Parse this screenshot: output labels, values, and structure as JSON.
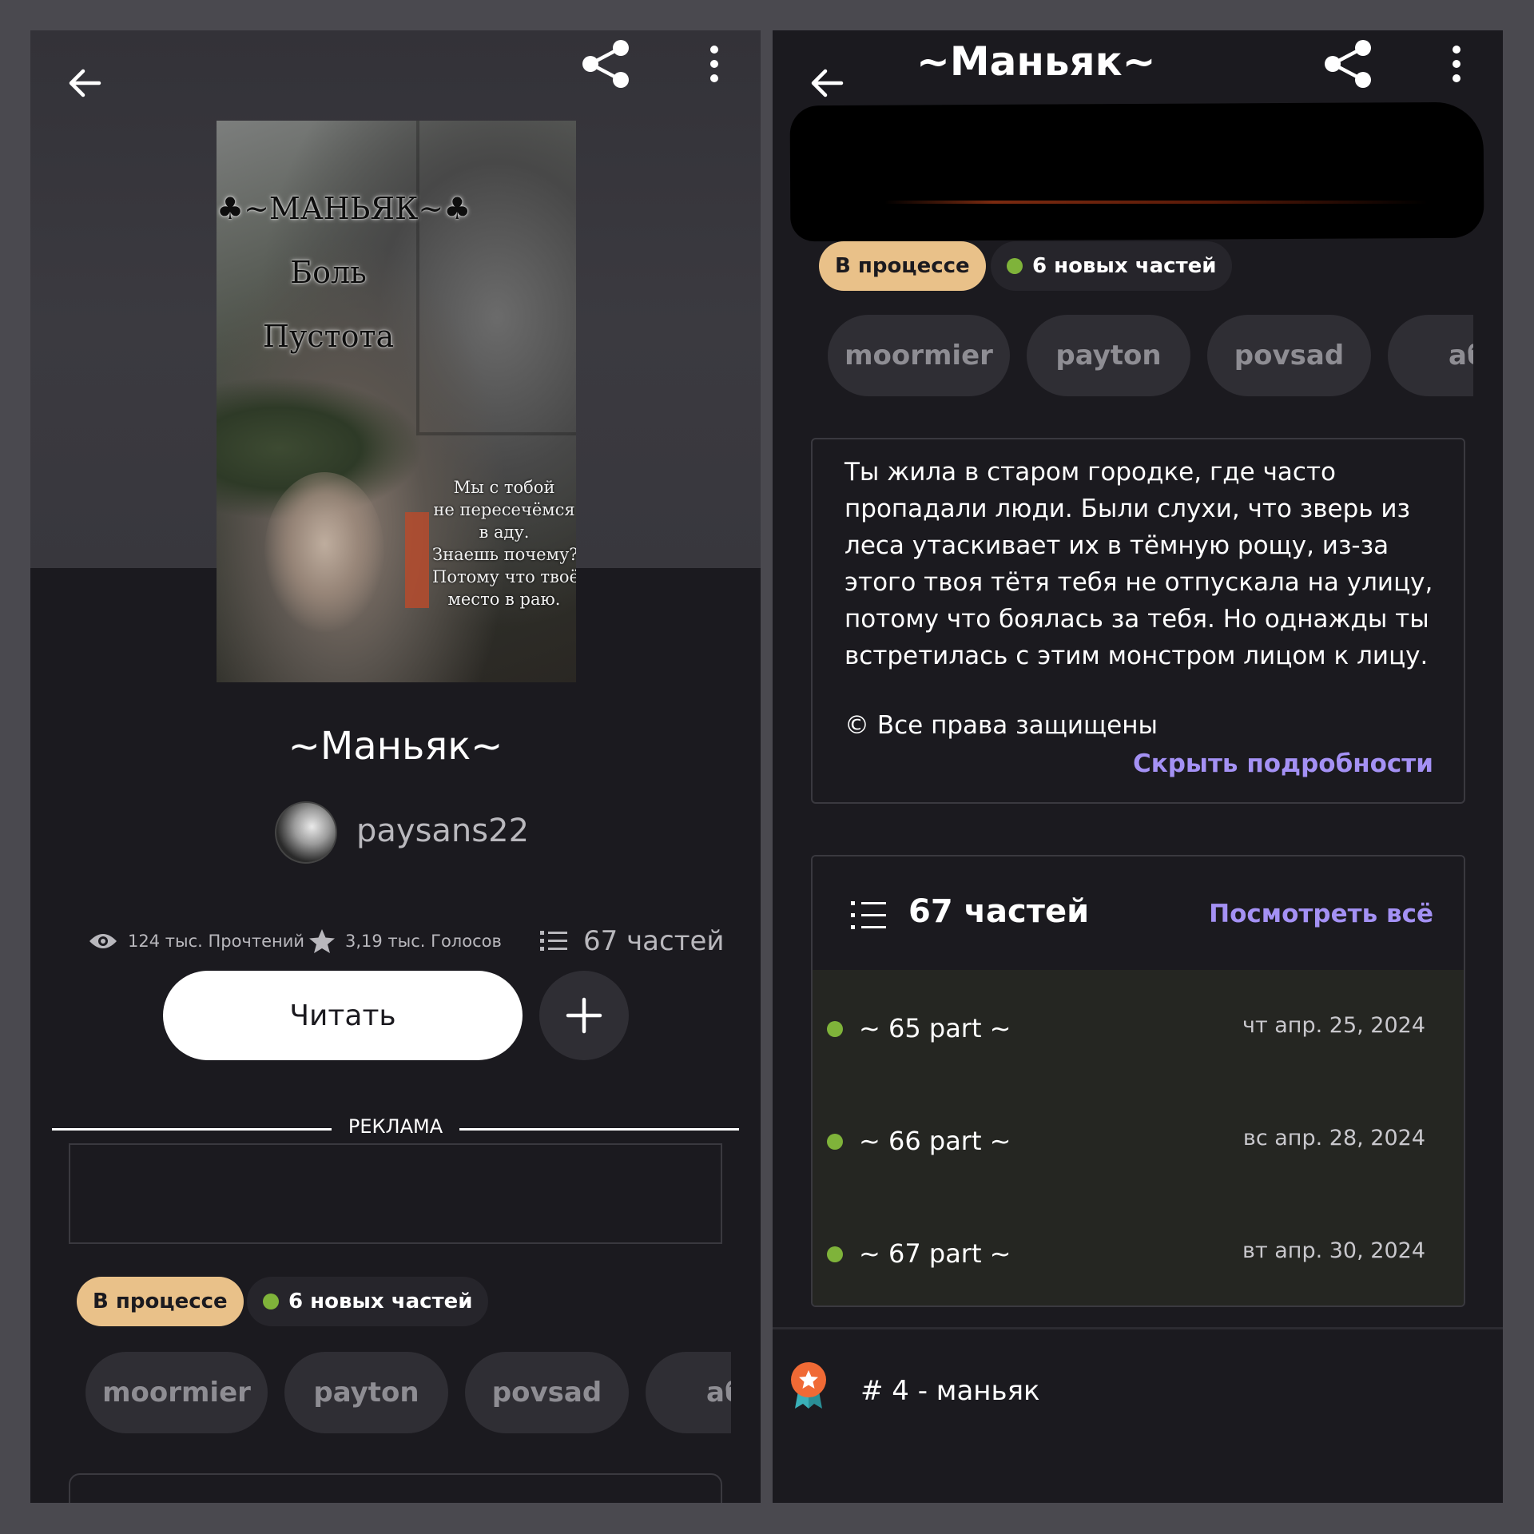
{
  "left": {
    "cover": {
      "title_lines": [
        "♣~МАНЬЯК~♣",
        "Боль",
        "Пустота"
      ],
      "quote_lines": [
        "Мы с тобой",
        "не пересечёмся",
        "в аду.",
        "Знаешь почему?",
        "Потому что твоё",
        "место в раю."
      ]
    },
    "title": "~Маньяк~",
    "author": "paysans22",
    "stats": {
      "reads": "124 тыс. Прочтений",
      "votes": "3,19 тыс. Голосов",
      "parts": "67 частей"
    },
    "read_label": "Читать",
    "add_label": "+",
    "ad_label": "РЕКЛАМА",
    "status_badge": "В процессе",
    "new_parts_badge": "6 новых частей",
    "tags": [
      "moormier",
      "payton",
      "povsad",
      "аб"
    ]
  },
  "right": {
    "title": "~Маньяк~",
    "status_badge": "В процессе",
    "new_parts_badge": "6 новых частей",
    "tags": [
      "moormier",
      "payton",
      "povsad",
      "аб"
    ],
    "description_lines": [
      "Ты жила в старом городке, где часто",
      "пропадали люди. Были слухи, что зверь из",
      "леса утаскивает их в тёмную рощу, из-за",
      "этого твоя тётя тебя не отпускала на улицу,",
      "потому что боялась за тебя. Но однажды ты",
      "встретилась с этим монстром лицом к лицу."
    ],
    "copyright": "© Все права защищены",
    "hide_details": "Скрыть подробности",
    "parts_count": "67 частей",
    "view_all": "Посмотреть всё",
    "parts": [
      {
        "title": "~ 65 part ~",
        "date": "чт апр. 25, 2024"
      },
      {
        "title": "~ 66 part ~",
        "date": "вс апр. 28, 2024"
      },
      {
        "title": "~ 67 part ~",
        "date": "вт апр. 30, 2024"
      }
    ],
    "rank": "# 4 - маньяк"
  },
  "colors": {
    "panel_bg": "#1b1a1f",
    "page_bg": "#4a494f",
    "status_badge": "#e9c189",
    "new_dot": "#7fb33a",
    "accent_link": "#a491f4",
    "tag_bg": "#2f2e34",
    "parts_list_bg": "#252622"
  },
  "icons": [
    "back-arrow-icon",
    "share-icon",
    "more-vertical-icon",
    "eye-icon",
    "star-icon",
    "list-icon",
    "plus-icon",
    "award-badge-icon"
  ]
}
